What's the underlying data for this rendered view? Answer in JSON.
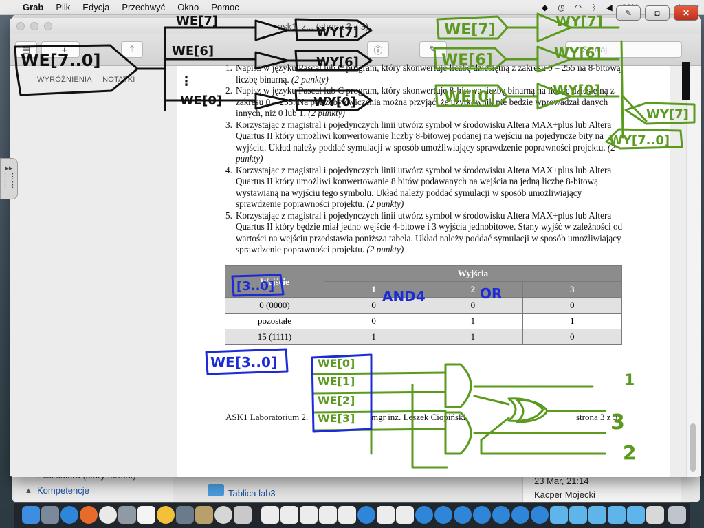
{
  "menubar": {
    "app": "Grab",
    "items": [
      "Plik",
      "Edycja",
      "Przechwyć",
      "Okno",
      "Pomoc"
    ],
    "battery": "99%",
    "clock": "Niedz"
  },
  "background_window": {
    "list_row_1": "Pliki kalerd (stary format)",
    "list_row_2": "Kompetencje",
    "folder": "Tablica lab3",
    "date": "23 Mar, 21:14",
    "author": "Kacper Mojecki"
  },
  "preview": {
    "title": "ask1_z... (strona 3 z 3)",
    "search_placeholder": "Szukaj",
    "sidebar_tabs": [
      "WYRÓŻNIENIA",
      "NOTATKI"
    ]
  },
  "document": {
    "tasks": [
      {
        "num": "1.",
        "text": "Napisz w języku Pascal lub C program, który skonwertuje liczbę dziesiętną z zakresu 0 – 255 na 8-bitową liczbę binarną.",
        "points": "(2 punkty)"
      },
      {
        "num": "2.",
        "text": "Napisz w języku Pascal lub C program, który skonwertuje 8-bitową liczbę binarną na liczbę dziesiętną z zakresu 0 – 255. Na potrzeby ćwiczenia można przyjąć, że użytkownik nie będzie wprowadzał danych innych, niż 0 lub 1.",
        "points": "(2 punkty)"
      },
      {
        "num": "3.",
        "text": "Korzystając z magistral i pojedynczych linii utwórz symbol w środowisku Altera MAX+plus lub Altera Quartus II który umożliwi konwertowanie liczby 8-bitowej podanej na wejściu na pojedyncze bity na wyjściu. Układ należy poddać symulacji w sposób umożliwiający sprawdzenie poprawności projektu.",
        "points": "(2 punkty)"
      },
      {
        "num": "4.",
        "text": "Korzystając z magistral i pojedynczych linii utwórz symbol w środowisku Altera MAX+plus lub Altera Quartus II który umożliwi konwertowanie 8 bitów podawanych na wejścia na jedną liczbę 8-bitową wystawianą na wyjściu tego symbolu. Układ należy poddać symulacji w sposób umożliwiający sprawdzenie poprawności projektu.",
        "points": "(2 punkty)"
      },
      {
        "num": "5.",
        "text": "Korzystając z magistral i pojedynczych linii utwórz symbol w środowisku Altera MAX+plus lub Altera Quartus II który będzie miał jedno wejście 4-bitowe i 3 wyjścia jednobitowe. Stany wyjść w zależności od wartości na wejściu przedstawia poniższa tabela. Układ należy poddać symulacji w sposób umożliwiający sprawdzenie poprawności projektu.",
        "points": "(2 punkty)"
      }
    ],
    "table": {
      "header_input": "Wejście",
      "header_outputs": "Wyjścia",
      "output_cols": [
        "1",
        "2",
        "3"
      ],
      "rows": [
        {
          "input": "0  (0000)",
          "out": [
            "0",
            "0",
            "0"
          ]
        },
        {
          "input": "pozostałe",
          "out": [
            "0",
            "1",
            "1"
          ]
        },
        {
          "input": "15 (1111)",
          "out": [
            "1",
            "1",
            "0"
          ]
        }
      ]
    },
    "footer": {
      "left": "ASK1 Laboratorium 2.",
      "middle": "mgr inż. Leszek Ciopiński",
      "right": "strona 3 z 3"
    }
  },
  "annotations": {
    "black": [
      "WE[7..0]",
      "WE[7]",
      "WE[6]",
      "WE[0]",
      "WY[7]",
      "WY[6]",
      "WY[0]"
    ],
    "green": [
      "WE[7]",
      "WE[6]",
      "WE[0]",
      "WY[7]",
      "WY[6]",
      "WY[0]",
      "WY[7]",
      "WY[7..0]",
      "WE[0]",
      "WE[1]",
      "WE[2]",
      "WE[3]",
      "1",
      "3",
      "2"
    ],
    "blue": [
      "[3..0]",
      "AND4",
      "OR",
      "WE[3..0]"
    ]
  },
  "colors": {
    "ink_green": "#5a9a1e",
    "ink_blue": "#1c2bd8",
    "ink_black": "#111111",
    "table_header": "#8c8c8c"
  },
  "icons": [
    "apple-icon",
    "dropbox-icon",
    "wifi-icon",
    "bluetooth-icon",
    "volume-icon",
    "battery-icon",
    "search-icon",
    "share-icon",
    "sidebar-toggle-icon",
    "pen-icon",
    "camera-icon",
    "close-icon"
  ]
}
